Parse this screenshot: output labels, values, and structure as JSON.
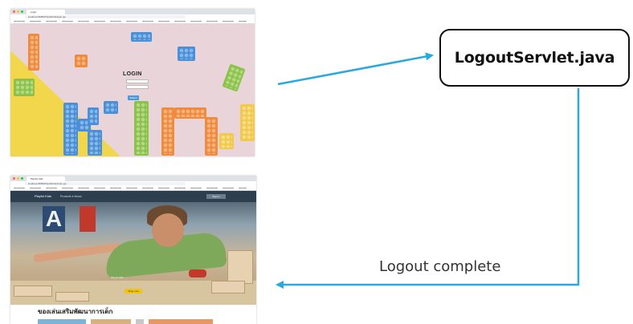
{
  "screenshots": {
    "login": {
      "browser_tab": "Login",
      "address": "localhost:8080/PlayfulKids/login.jsp",
      "heading": "LOGIN",
      "button": "Submit"
    },
    "home": {
      "browser_tab": "Playful Kids",
      "address": "localhost:8080/PlayfulKids/index.jsp",
      "brand": "Playful Kids",
      "nav_links": "Products ▾   About",
      "nav_button": "Sign in",
      "hero_letter": "A",
      "hero_caption": "Playful Kids",
      "hero_cta": "Shop now",
      "section_heading": "ของเล่นเสริมพัฒนาการเด็ก"
    }
  },
  "nodes": {
    "servlet": "LogoutServlet.java"
  },
  "edges": [
    {
      "from": "login-screenshot",
      "to": "servlet",
      "label": ""
    },
    {
      "from": "servlet",
      "to": "home-screenshot",
      "label": "Logout complete"
    }
  ],
  "colors": {
    "arrow": "#29a9e0",
    "box_border": "#111111"
  }
}
